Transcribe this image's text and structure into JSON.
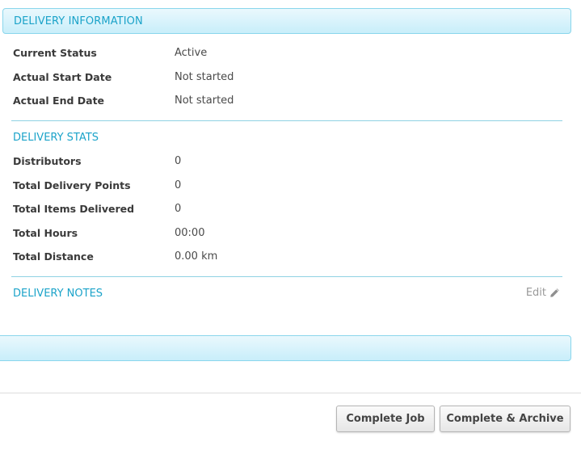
{
  "delivery_information": {
    "title": "DELIVERY INFORMATION",
    "rows": [
      {
        "label": "Current Status",
        "value": "Active"
      },
      {
        "label": "Actual Start Date",
        "value": "Not started"
      },
      {
        "label": "Actual End Date",
        "value": "Not started"
      }
    ]
  },
  "delivery_stats": {
    "title": "DELIVERY STATS",
    "rows": [
      {
        "label": "Distributors",
        "value": "0"
      },
      {
        "label": "Total Delivery Points",
        "value": "0"
      },
      {
        "label": "Total Items Delivered",
        "value": "0"
      },
      {
        "label": "Total Hours",
        "value": "00:00"
      },
      {
        "label": "Total Distance",
        "value": "0.00 km"
      }
    ]
  },
  "delivery_notes": {
    "title": "DELIVERY NOTES",
    "edit_label": "Edit",
    "edit_icon": "pencil-icon"
  },
  "actions": {
    "complete_job_label": "Complete Job",
    "complete_archive_label": "Complete & Archive"
  },
  "colors": {
    "accent": "#1ba3c9",
    "header_bg": "#c8eefa",
    "header_border": "#8ad6ec"
  }
}
